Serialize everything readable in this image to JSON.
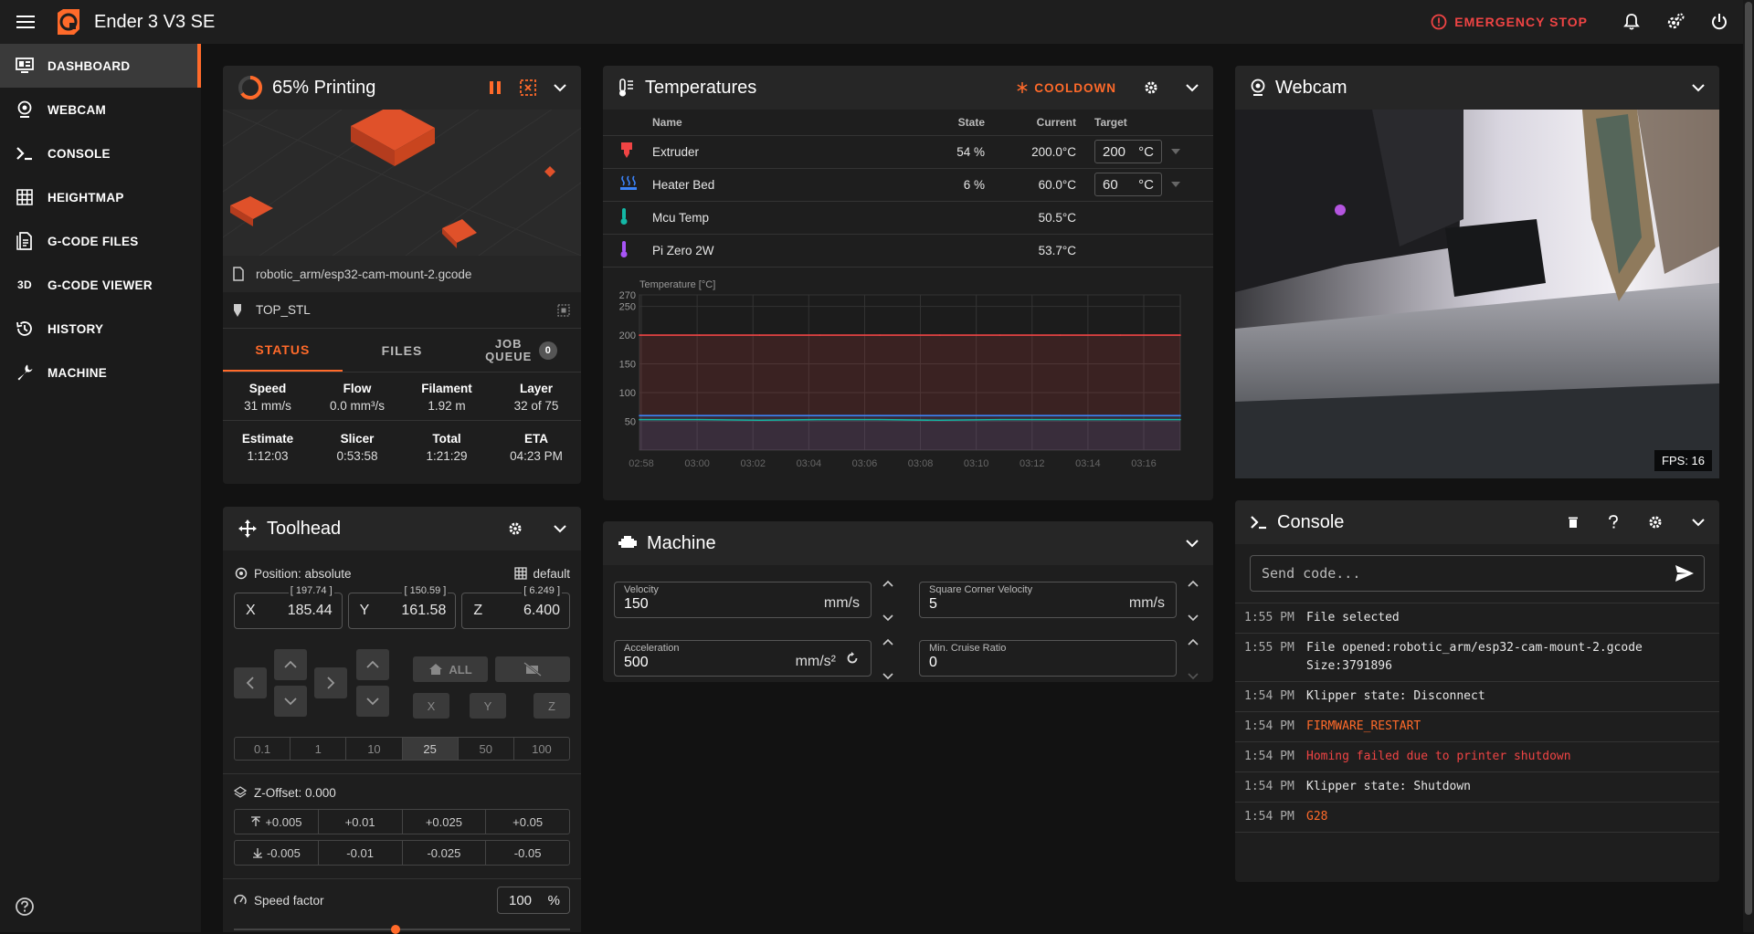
{
  "app": {
    "title": "Ender 3 V3 SE",
    "emergency_stop": "EMERGENCY STOP"
  },
  "nav": [
    {
      "label": "DASHBOARD",
      "icon": "dashboard-icon",
      "active": true
    },
    {
      "label": "WEBCAM",
      "icon": "webcam-icon"
    },
    {
      "label": "CONSOLE",
      "icon": "console-icon"
    },
    {
      "label": "HEIGHTMAP",
      "icon": "grid-icon"
    },
    {
      "label": "G-CODE FILES",
      "icon": "files-icon"
    },
    {
      "label": "G-CODE VIEWER",
      "icon": "3d-icon",
      "icon_text": "3D"
    },
    {
      "label": "HISTORY",
      "icon": "history-icon"
    },
    {
      "label": "MACHINE",
      "icon": "wrench-icon"
    }
  ],
  "status_card": {
    "title": "65% Printing",
    "progress": 0.65,
    "filename": "robotic_arm/esp32-cam-mount-2.gcode",
    "object": "TOP_STL",
    "tabs": [
      "STATUS",
      "FILES",
      "JOB",
      "QUEUE"
    ],
    "queue_count": "0",
    "stats_row1": [
      {
        "label": "Speed",
        "value": "31 mm/s"
      },
      {
        "label": "Flow",
        "value": "0.0 mm³/s"
      },
      {
        "label": "Filament",
        "value": "1.92 m"
      },
      {
        "label": "Layer",
        "value": "32 of 75"
      }
    ],
    "stats_row2": [
      {
        "label": "Estimate",
        "value": "1:12:03"
      },
      {
        "label": "Slicer",
        "value": "0:53:58"
      },
      {
        "label": "Total",
        "value": "1:21:29"
      },
      {
        "label": "ETA",
        "value": "04:23 PM"
      }
    ]
  },
  "toolhead": {
    "title": "Toolhead",
    "position_mode": "Position: absolute",
    "profile": "default",
    "axes": [
      {
        "axis": "X",
        "value": "185.44",
        "target": "[ 197.74 ]"
      },
      {
        "axis": "Y",
        "value": "161.58",
        "target": "[ 150.59 ]"
      },
      {
        "axis": "Z",
        "value": "6.400",
        "target": "[ 6.249 ]"
      }
    ],
    "home_all": "ALL",
    "home_axes": [
      "X",
      "Y",
      "Z"
    ],
    "steps": [
      "0.1",
      "1",
      "10",
      "25",
      "50",
      "100"
    ],
    "active_step": "25",
    "z_offset": "Z-Offset: 0.000",
    "z_up": [
      "+0.005",
      "+0.01",
      "+0.025",
      "+0.05"
    ],
    "z_down": [
      "-0.005",
      "-0.01",
      "-0.025",
      "-0.05"
    ],
    "speed_factor_label": "Speed factor",
    "speed_factor_value": "100",
    "speed_factor_unit": "%"
  },
  "temperatures": {
    "title": "Temperatures",
    "cooldown": "COOLDOWN",
    "headers": {
      "name": "Name",
      "state": "State",
      "current": "Current",
      "target": "Target"
    },
    "rows": [
      {
        "name": "Extruder",
        "state": "54 %",
        "current": "200.0°C",
        "target": "200",
        "unit": "°C",
        "icon": "extruder-icon",
        "color": "#ef4444"
      },
      {
        "name": "Heater Bed",
        "state": "6 %",
        "current": "60.0°C",
        "target": "60",
        "unit": "°C",
        "icon": "heater-bed-icon",
        "color": "#3b82f6"
      },
      {
        "name": "Mcu Temp",
        "state": "",
        "current": "50.5°C",
        "target": "",
        "unit": "",
        "icon": "thermometer-icon",
        "color": "#14b8a6"
      },
      {
        "name": "Pi Zero 2W",
        "state": "",
        "current": "53.7°C",
        "target": "",
        "unit": "",
        "icon": "thermometer-icon",
        "color": "#a855f7"
      }
    ]
  },
  "chart_data": {
    "type": "line",
    "ylabel": "Temperature [°C]",
    "yticks": [
      50,
      100,
      150,
      200,
      250,
      270
    ],
    "ylim": [
      0,
      270
    ],
    "x": [
      "02:58",
      "03:00",
      "03:02",
      "03:04",
      "03:06",
      "03:08",
      "03:10",
      "03:12",
      "03:14",
      "03:16"
    ],
    "series": [
      {
        "color": "#ef4444",
        "values": [
          200,
          200,
          200,
          200,
          200,
          200,
          200,
          200,
          200,
          200
        ]
      },
      {
        "color": "#3b82f6",
        "values": [
          60,
          60,
          60,
          60,
          60,
          60,
          60,
          60,
          60,
          60
        ]
      },
      {
        "color": "#14b8a6",
        "values": [
          53,
          53,
          52,
          53,
          53,
          52,
          53,
          53,
          53,
          53
        ]
      }
    ],
    "grid": true
  },
  "machine": {
    "title": "Machine",
    "fields": [
      {
        "label": "Velocity",
        "value": "150",
        "unit": "mm/s"
      },
      {
        "label": "Square Corner Velocity",
        "value": "5",
        "unit": "mm/s"
      },
      {
        "label": "Acceleration",
        "value": "500",
        "unit": "mm/s²"
      },
      {
        "label": "Min. Cruise Ratio",
        "value": "0",
        "unit": ""
      }
    ]
  },
  "webcam": {
    "title": "Webcam",
    "fps": "FPS: 16"
  },
  "console": {
    "title": "Console",
    "placeholder": "Send code...",
    "lines": [
      {
        "time": "1:55 PM",
        "msg": "File selected",
        "kind": "normal"
      },
      {
        "time": "1:55 PM",
        "msg": "File opened:robotic_arm/esp32-cam-mount-2.gcode Size:3791896",
        "kind": "normal"
      },
      {
        "time": "1:54 PM",
        "msg": "Klipper state: Disconnect",
        "kind": "normal"
      },
      {
        "time": "1:54 PM",
        "msg": "FIRMWARE_RESTART",
        "kind": "warn"
      },
      {
        "time": "1:54 PM",
        "msg": "Homing failed due to printer shutdown",
        "kind": "err"
      },
      {
        "time": "1:54 PM",
        "msg": "Klipper state: Shutdown",
        "kind": "normal"
      },
      {
        "time": "1:54 PM",
        "msg": "G28",
        "kind": "warn"
      }
    ]
  }
}
